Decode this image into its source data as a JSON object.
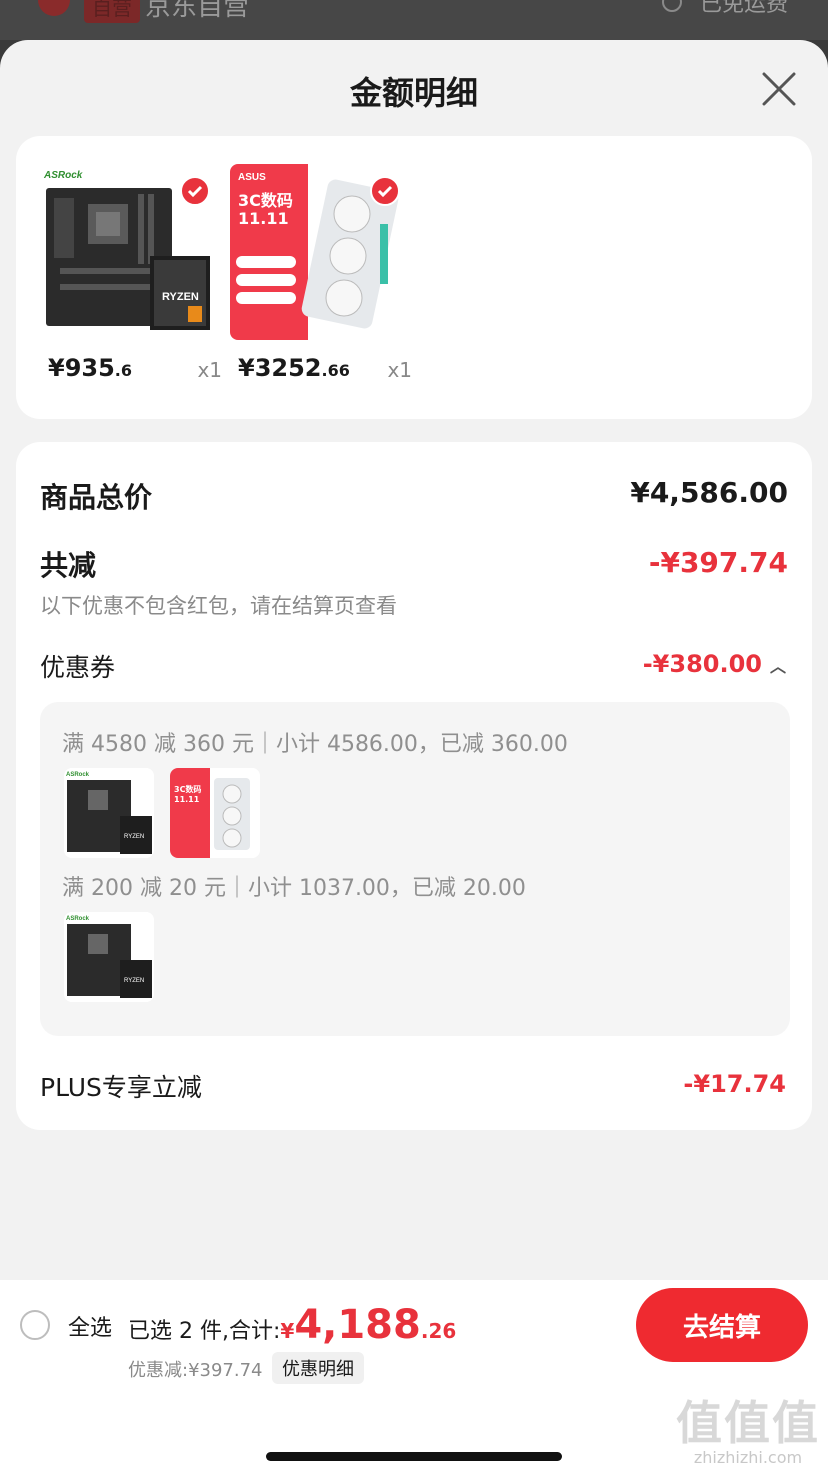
{
  "background": {
    "shop_tag": "自营",
    "shop_name": "京东自营",
    "freight": "已免运费"
  },
  "sheet": {
    "title": "金额明细",
    "close_icon": "close-icon"
  },
  "products": [
    {
      "price_int": "¥935",
      "price_dec": ".6",
      "qty": "x1",
      "brand": "ASRock",
      "checked": true
    },
    {
      "price_int": "¥3252",
      "price_dec": ".66",
      "qty": "x1",
      "brand": "ASUS",
      "checked": true
    }
  ],
  "details": {
    "total_label": "商品总价",
    "total_value": "¥4,586.00",
    "reduce_label": "共减",
    "reduce_value": "-¥397.74",
    "reduce_note": "以下优惠不包含红包，请在结算页查看",
    "coupon_label": "优惠券",
    "coupon_value": "-¥380.00",
    "coupon_rules": [
      {
        "text": "满 4580 减 360 元｜小计 4586.00，已减 360.00"
      },
      {
        "text": "满 200 减 20 元｜小计 1037.00，已减 20.00"
      }
    ],
    "plus_label": "PLUS专享立减",
    "plus_value": "-¥17.74"
  },
  "bottom": {
    "select_all": "全选",
    "selected_text": "已选 2 件,合计:",
    "currency": "¥",
    "total_int": "4,188",
    "total_dec": ".26",
    "discount_text": "优惠减:¥397.74",
    "discount_link": "优惠明细",
    "checkout": "去结算",
    "watermark_big": "值值值",
    "watermark_small": "zhizhizhi.com"
  },
  "colors": {
    "accent": "#e8323c",
    "checkout_bg": "#ef2a30",
    "sheet_bg": "#f2f2f2"
  }
}
